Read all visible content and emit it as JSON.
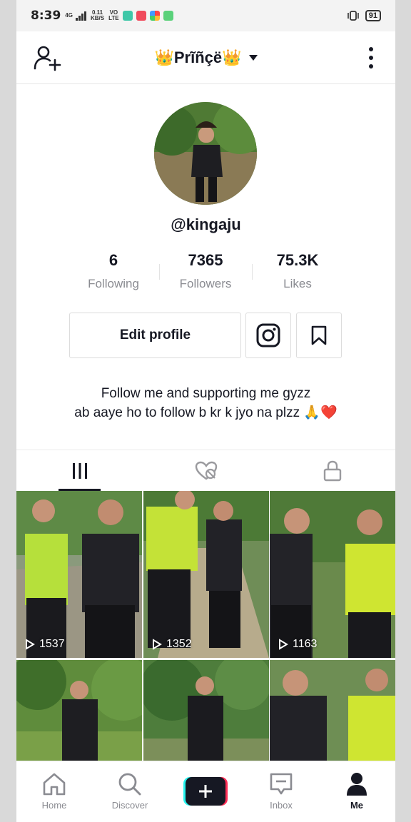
{
  "status_bar": {
    "time": "8:39",
    "net_top": "4G",
    "speed": "0.11",
    "speed_unit": "KB/S",
    "volte_top": "VO",
    "volte_bottom": "LTE",
    "battery": "91"
  },
  "header": {
    "title": "👑Prĩñçë👑"
  },
  "profile": {
    "username": "@kingaju",
    "stats": [
      {
        "value": "6",
        "label": "Following"
      },
      {
        "value": "7365",
        "label": "Followers"
      },
      {
        "value": "75.3K",
        "label": "Likes"
      }
    ],
    "edit_label": "Edit profile",
    "bio_line1": "Follow me and supporting me gyzz",
    "bio_line2": "ab aaye ho to follow b kr k jyo na plzz 🙏❤️"
  },
  "videos": [
    {
      "views": "1537"
    },
    {
      "views": "1352"
    },
    {
      "views": "1163"
    },
    {
      "views": ""
    },
    {
      "views": ""
    },
    {
      "views": ""
    }
  ],
  "bottom_nav": [
    {
      "label": "Home",
      "icon": "home-icon"
    },
    {
      "label": "Discover",
      "icon": "search-icon"
    },
    {
      "label": "",
      "icon": "plus-icon"
    },
    {
      "label": "Inbox",
      "icon": "inbox-icon"
    },
    {
      "label": "Me",
      "icon": "person-icon"
    }
  ],
  "colors": {
    "text": "#161823",
    "muted": "#8a8b91",
    "accent_cyan": "#25f4ee",
    "accent_pink": "#fe2c55"
  }
}
